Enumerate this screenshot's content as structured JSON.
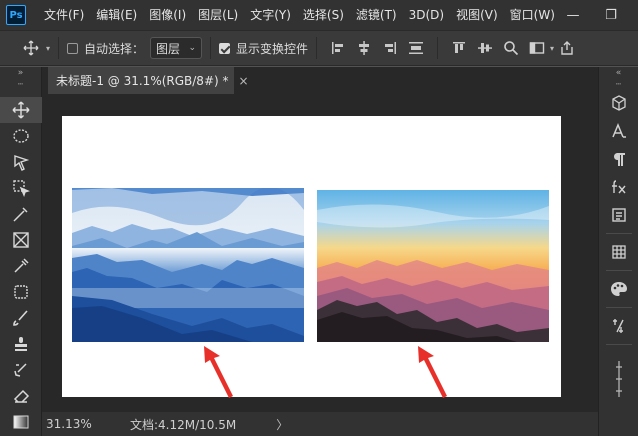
{
  "app": {
    "logo": "Ps"
  },
  "menu": {
    "items": [
      "文件(F)",
      "编辑(E)",
      "图像(I)",
      "图层(L)",
      "文字(Y)",
      "选择(S)",
      "滤镜(T)",
      "3D(D)",
      "视图(V)",
      "窗口(W)"
    ]
  },
  "window_controls": {
    "minimize": "—",
    "restore": "❐"
  },
  "options": {
    "auto_select_label": "自动选择：",
    "auto_select_checked": false,
    "layer_dropdown": "图层",
    "show_transform_label": "显示变换控件",
    "show_transform_checked": true
  },
  "document": {
    "tab_title": "未标题-1 @ 31.1%(RGB/8#) *",
    "close": "×"
  },
  "status": {
    "zoom": "31.13%",
    "doc_info": "文档:4.12M/10.5M",
    "arrow": "〉"
  },
  "colors": {
    "accent": "#31a8ff",
    "arrow_red": "#e8302a"
  },
  "icons": {
    "left_tools": [
      "move-icon",
      "ellipse-marquee-icon",
      "lasso-icon",
      "object-select-icon",
      "eyedropper-icon",
      "frame-icon",
      "spot-healing-icon",
      "stamp-icon",
      "brush-icon",
      "clone-stamp-icon",
      "history-brush-icon",
      "eraser-icon",
      "gradient-icon"
    ],
    "right_panels": [
      "3d-cube-icon",
      "character-icon",
      "paragraph-icon",
      "fx-icon",
      "layers-panel-icon",
      "swatches-icon",
      "palette-icon",
      "adjust-icon",
      "properties-icon"
    ]
  }
}
